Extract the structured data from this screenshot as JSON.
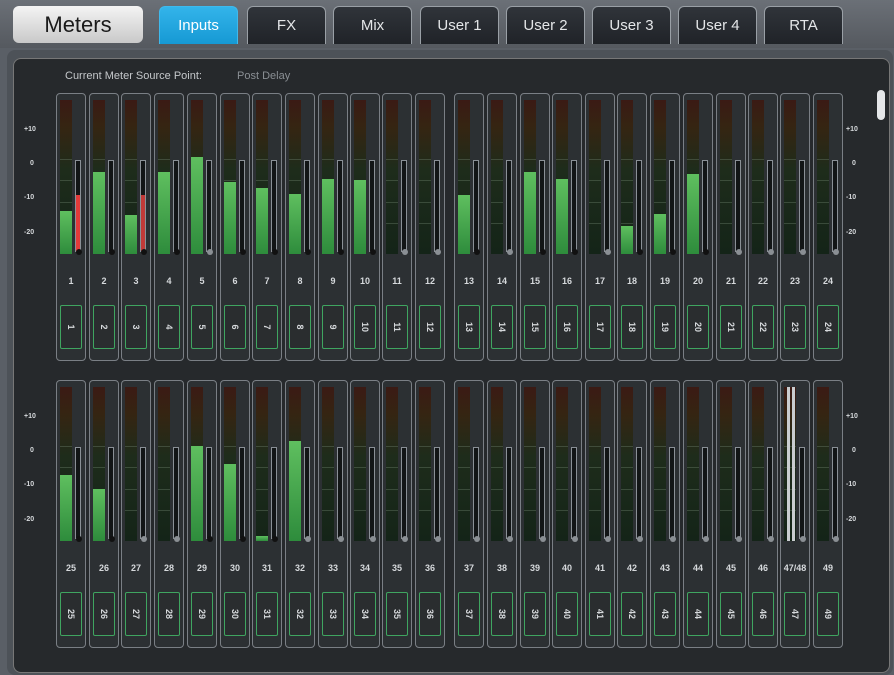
{
  "title": "Meters",
  "tabs": [
    "Inputs",
    "FX",
    "Mix",
    "User 1",
    "User 2",
    "User 3",
    "User 4",
    "RTA"
  ],
  "active_tab": "Inputs",
  "source_point_label": "Current Meter Source Point:",
  "source_point_value": "Post Delay",
  "scale_labels": [
    "+10",
    "0",
    "-10",
    "-20"
  ],
  "colors": {
    "accent": "#1699d4",
    "meter_green": "#4caf50",
    "peak_red": "#e33a3a",
    "button_border": "#3fa560"
  },
  "rows": [
    {
      "channels": [
        {
          "label": "1",
          "level": 0.28,
          "peak": 0.62,
          "peak_red": true,
          "dot": "black"
        },
        {
          "label": "2",
          "level": 0.53,
          "peak": 0,
          "dot": "black"
        },
        {
          "label": "3",
          "level": 0.25,
          "peak": 0.62,
          "dot": "black"
        },
        {
          "label": "4",
          "level": 0.53,
          "peak": 0,
          "dot": "black"
        },
        {
          "label": "5",
          "level": 0.63,
          "peak": 0,
          "dot": "gray"
        },
        {
          "label": "6",
          "level": 0.47,
          "peak": 0,
          "dot": "black"
        },
        {
          "label": "7",
          "level": 0.43,
          "peak": 0,
          "dot": "black"
        },
        {
          "label": "8",
          "level": 0.39,
          "peak": 0,
          "dot": "black"
        },
        {
          "label": "9",
          "level": 0.49,
          "peak": 0,
          "dot": "black"
        },
        {
          "label": "10",
          "level": 0.48,
          "peak": 0,
          "dot": "black"
        },
        {
          "label": "11",
          "level": 0,
          "peak": 0,
          "dot": "gray"
        },
        {
          "label": "12",
          "level": 0,
          "peak": 0,
          "dot": "gray"
        },
        {
          "label": "13",
          "level": 0.38,
          "peak": 0,
          "dot": "black"
        },
        {
          "label": "14",
          "level": 0,
          "peak": 0,
          "dot": "gray"
        },
        {
          "label": "15",
          "level": 0.53,
          "peak": 0,
          "dot": "black"
        },
        {
          "label": "16",
          "level": 0.49,
          "peak": 0,
          "dot": "black"
        },
        {
          "label": "17",
          "level": 0,
          "peak": 0,
          "dot": "gray"
        },
        {
          "label": "18",
          "level": 0.18,
          "peak": 0,
          "dot": "black"
        },
        {
          "label": "19",
          "level": 0.26,
          "peak": 0,
          "dot": "black"
        },
        {
          "label": "20",
          "level": 0.52,
          "peak": 0,
          "dot": "black"
        },
        {
          "label": "21",
          "level": 0,
          "peak": 0,
          "dot": "gray"
        },
        {
          "label": "22",
          "level": 0,
          "peak": 0,
          "dot": "gray"
        },
        {
          "label": "23",
          "level": 0,
          "peak": 0,
          "dot": "gray"
        },
        {
          "label": "24",
          "level": 0,
          "peak": 0,
          "dot": "gray"
        }
      ],
      "buttons": [
        "1",
        "2",
        "3",
        "4",
        "5",
        "6",
        "7",
        "8",
        "9",
        "10",
        "11",
        "12",
        "13",
        "14",
        "15",
        "16",
        "17",
        "18",
        "19",
        "20",
        "21",
        "22",
        "23",
        "24"
      ]
    },
    {
      "channels": [
        {
          "label": "25",
          "level": 0.43,
          "peak": 0,
          "dot": "black"
        },
        {
          "label": "26",
          "level": 0.34,
          "peak": 0,
          "dot": "black"
        },
        {
          "label": "27",
          "level": 0,
          "peak": 0,
          "dot": "gray"
        },
        {
          "label": "28",
          "level": 0,
          "peak": 0,
          "dot": "gray"
        },
        {
          "label": "29",
          "level": 0.62,
          "peak": 0,
          "dot": "black"
        },
        {
          "label": "30",
          "level": 0.5,
          "peak": 0,
          "dot": "black"
        },
        {
          "label": "31",
          "level": 0.03,
          "peak": 0,
          "dot": "black"
        },
        {
          "label": "32",
          "level": 0.65,
          "peak": 0,
          "dot": "gray"
        },
        {
          "label": "33",
          "level": 0,
          "peak": 0,
          "dot": "gray"
        },
        {
          "label": "34",
          "level": 0,
          "peak": 0,
          "dot": "gray"
        },
        {
          "label": "35",
          "level": 0,
          "peak": 0,
          "dot": "gray"
        },
        {
          "label": "36",
          "level": 0,
          "peak": 0,
          "dot": "gray"
        },
        {
          "label": "37",
          "level": 0,
          "peak": 0,
          "dot": "gray"
        },
        {
          "label": "38",
          "level": 0,
          "peak": 0,
          "dot": "gray"
        },
        {
          "label": "39",
          "level": 0,
          "peak": 0,
          "dot": "gray"
        },
        {
          "label": "40",
          "level": 0,
          "peak": 0,
          "dot": "gray"
        },
        {
          "label": "41",
          "level": 0,
          "peak": 0,
          "dot": "gray"
        },
        {
          "label": "42",
          "level": 0,
          "peak": 0,
          "dot": "gray"
        },
        {
          "label": "43",
          "level": 0,
          "peak": 0,
          "dot": "gray"
        },
        {
          "label": "44",
          "level": 0,
          "peak": 0,
          "dot": "gray"
        },
        {
          "label": "45",
          "level": 0,
          "peak": 0,
          "dot": "gray"
        },
        {
          "label": "46",
          "level": 0,
          "peak": 0,
          "dot": "gray"
        },
        {
          "label": "47/48",
          "level": 0,
          "peak": 0,
          "dot": "gray",
          "stereo": true
        },
        {
          "label": "49",
          "level": 0,
          "peak": 0,
          "dot": "gray"
        }
      ],
      "buttons": [
        "25",
        "26",
        "27",
        "28",
        "29",
        "30",
        "31",
        "32",
        "33",
        "34",
        "35",
        "36",
        "37",
        "38",
        "39",
        "40",
        "41",
        "42",
        "43",
        "44",
        "45",
        "46",
        "47",
        "49"
      ]
    }
  ]
}
